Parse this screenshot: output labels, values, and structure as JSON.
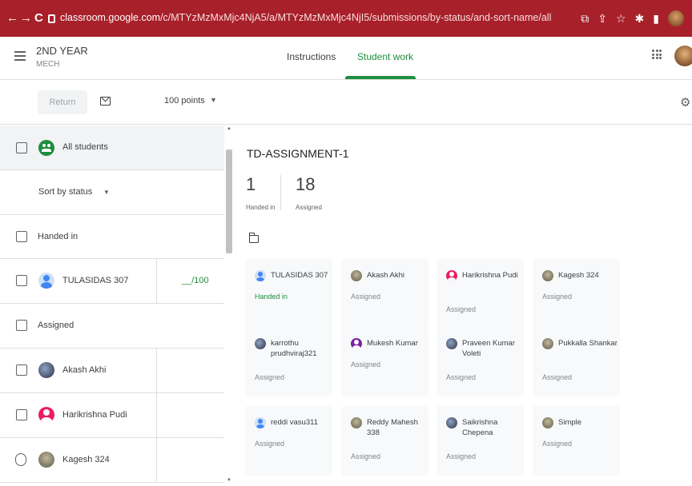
{
  "browser": {
    "url_domain": "classroom.google.com",
    "url_path": "/c/MTYzMzMxMjc4NjA5/a/MTYzMzMxMjc4NjI5/submissions/by-status/and-sort-name/all",
    "colors": {
      "chrome_bg": "#a8202a"
    }
  },
  "course": {
    "title": "2ND YEAR",
    "section": "MECH"
  },
  "tabs": {
    "instructions": "Instructions",
    "student_work": "Student work"
  },
  "toolbar": {
    "return_label": "Return",
    "points_label": "100 points"
  },
  "left_panel": {
    "all_students_label": "All students",
    "sort_label": "Sort by status",
    "handed_in_header": "Handed in",
    "assigned_header": "Assigned",
    "handed_in_students": [
      {
        "name": "TULASIDAS 307",
        "grade": "__/100"
      }
    ],
    "assigned_students": [
      {
        "name": "Akash Akhi"
      },
      {
        "name": "Harikrishna Pudi"
      },
      {
        "name": "Kagesh 324"
      }
    ]
  },
  "assignment": {
    "title": "TD-ASSIGNMENT-1",
    "handed_in_count": "1",
    "handed_in_label": "Handed in",
    "assigned_count": "18",
    "assigned_label": "Assigned"
  },
  "cards": [
    {
      "name": "TULASIDAS 307",
      "status": "Handed in",
      "avatar": "default"
    },
    {
      "name": "Akash Akhi",
      "status": "Assigned",
      "avatar": "photo"
    },
    {
      "name": "Harikrishna Pudi",
      "status": "Assigned",
      "avatar": "pink"
    },
    {
      "name": "Kagesh 324",
      "status": "Assigned",
      "avatar": "photo"
    },
    {
      "name": "karrothu prudhviraj321",
      "status": "Assigned",
      "avatar": "photo"
    },
    {
      "name": "Mukesh Kumar",
      "status": "Assigned",
      "avatar": "purple"
    },
    {
      "name": "Praveen Kumar Voleti",
      "status": "Assigned",
      "avatar": "photo"
    },
    {
      "name": "Pukkalla Shankar",
      "status": "Assigned",
      "avatar": "photo"
    },
    {
      "name": "reddi vasu311",
      "status": "Assigned",
      "avatar": "default"
    },
    {
      "name": "Reddy Mahesh 338",
      "status": "Assigned",
      "avatar": "photo"
    },
    {
      "name": "Saikrishna Chepena",
      "status": "Assigned",
      "avatar": "photo"
    },
    {
      "name": "Simple",
      "status": "Assigned",
      "avatar": "photo"
    }
  ]
}
